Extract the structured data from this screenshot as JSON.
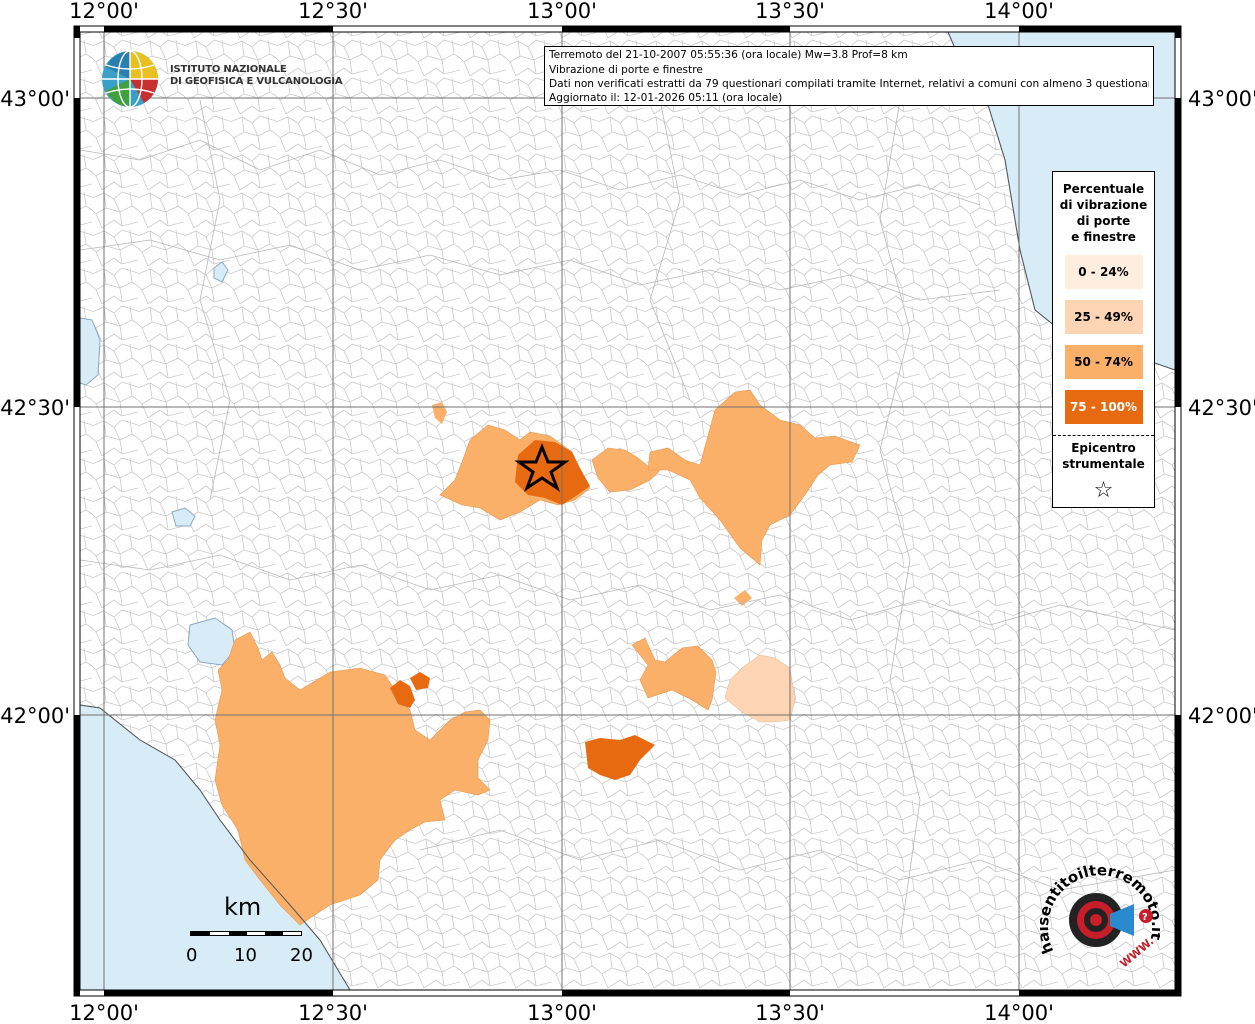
{
  "map": {
    "lon_labels": [
      "12°00'",
      "12°30'",
      "13°00'",
      "13°30'",
      "14°00'"
    ],
    "lat_labels": [
      "43°00'",
      "42°30'",
      "42°00'"
    ],
    "colors": {
      "sea": "#d8ecf8",
      "land": "#ffffff",
      "border": "#b8b8b8",
      "grid": "#707070",
      "class_0_24": "#fdeedf",
      "class_25_49": "#fdd5b4",
      "class_50_74": "#fbb06a",
      "class_75_100": "#e86a10"
    },
    "epicenter": {
      "lat": 42.41,
      "lon": 12.96,
      "symbol": "star-icon"
    }
  },
  "info": {
    "line1": "Terremoto del 21-10-2007 05:55:36 (ora locale) Mw=3.8 Prof=8 km",
    "line2": "Vibrazione di porte e finestre",
    "line3": "Dati non verificati estratti da 79 questionari compilati tramite Internet, relativi a comuni con almeno 3 questionari.",
    "line4": "Aggiornato il: 12-01-2026 05:11 (ora locale)"
  },
  "legend": {
    "title_lines": [
      "Percentuale",
      "di vibrazione",
      "di porte",
      "e finestre"
    ],
    "items": [
      {
        "label": "0 - 24%",
        "color": "#fdeedf"
      },
      {
        "label": "25 - 49%",
        "color": "#fdd5b4"
      },
      {
        "label": "50 - 74%",
        "color": "#fbb06a"
      },
      {
        "label": "75 - 100%",
        "color": "#e86a10"
      }
    ],
    "epicenter_lines": [
      "Epicentro",
      "strumentale"
    ],
    "star": "☆"
  },
  "logo": {
    "line1": "ISTITUTO NAZIONALE",
    "line2": "DI GEOFISICA E VULCANOLOGIA",
    "icon": "ingv-globe-icon"
  },
  "scale": {
    "unit": "km",
    "ticks": [
      "0",
      "10",
      "20"
    ]
  },
  "badge": {
    "text": "haisentitoilterremoto.it",
    "url_text": "WWW.",
    "icon": "target-megaphone-icon"
  }
}
